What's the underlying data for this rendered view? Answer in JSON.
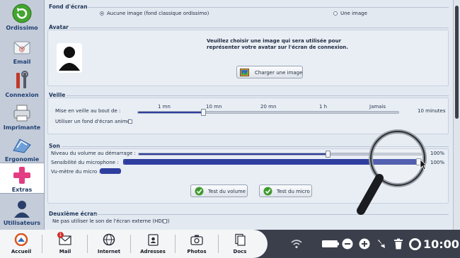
{
  "sidebar": {
    "items": [
      {
        "label": "Ordissimo",
        "icon": "back-arrow-icon"
      },
      {
        "label": "Email",
        "icon": "email-icon"
      },
      {
        "label": "Connexion",
        "icon": "tools-icon"
      },
      {
        "label": "Imprimante",
        "icon": "printer-icon"
      },
      {
        "label": "Ergonomie",
        "icon": "ergonomics-icon"
      },
      {
        "label": "Extras",
        "icon": "plus-icon"
      },
      {
        "label": "Utilisateurs",
        "icon": "user-icon"
      }
    ],
    "active": "Extras"
  },
  "wallpaper": {
    "title": "Fond d'écran",
    "option_none": "Aucune image (fond classique ordissimo)",
    "option_image": "Une image",
    "selected": "option_none"
  },
  "avatar": {
    "title": "Avatar",
    "instruction_line1": "Veuillez choisir une image qui sera utilisée pour",
    "instruction_line2": "représenter votre avatar sur l'écran de connexion.",
    "load_button": "Charger une image"
  },
  "sleep": {
    "title": "Veille",
    "label": "Mise en veille au bout de :",
    "ticks": [
      "1 mn",
      "10 mn",
      "20 mn",
      "1 h",
      "Jamais"
    ],
    "value": "10 minutes",
    "value_fraction": 0.25,
    "animated_wallpaper_label": "Utiliser un fond d'écran animé.",
    "animated_wallpaper_checked": false
  },
  "sound": {
    "title": "Son",
    "startup_volume_label": "Niveau du volume au démarrage :",
    "startup_volume_value": "100%",
    "startup_volume_level": 0.67,
    "mic_sensitivity_label": "Sensibilité du microphone :",
    "mic_sensitivity_value": "100%",
    "mic_sensitivity_level": 1.0,
    "mic_meter_label": "Vu-mètre du micro :",
    "mic_meter_level": 0.1,
    "test_volume_button": "Test du volume",
    "test_mic_button": "Test du micro"
  },
  "second_screen": {
    "title": "Deuxième écran",
    "hdmi_label": "Ne pas utiliser le son de l'écran externe (HDMI)",
    "hdmi_checked": false
  },
  "taskbar": {
    "items": [
      {
        "label": "Accueil",
        "icon": "home-icon"
      },
      {
        "label": "Mail",
        "icon": "mail-icon",
        "badge": "1"
      },
      {
        "label": "Internet",
        "icon": "globe-icon"
      },
      {
        "label": "Adresses",
        "icon": "address-book-icon"
      },
      {
        "label": "Photos",
        "icon": "camera-icon"
      },
      {
        "label": "Docs",
        "icon": "documents-icon"
      }
    ],
    "clock": "10:00"
  },
  "colors": {
    "accent": "#2e3e9e",
    "taskbar_dark": "#3a3f4b",
    "sidebar": "#c4ccd9",
    "active_green": "#3f9a2c"
  }
}
